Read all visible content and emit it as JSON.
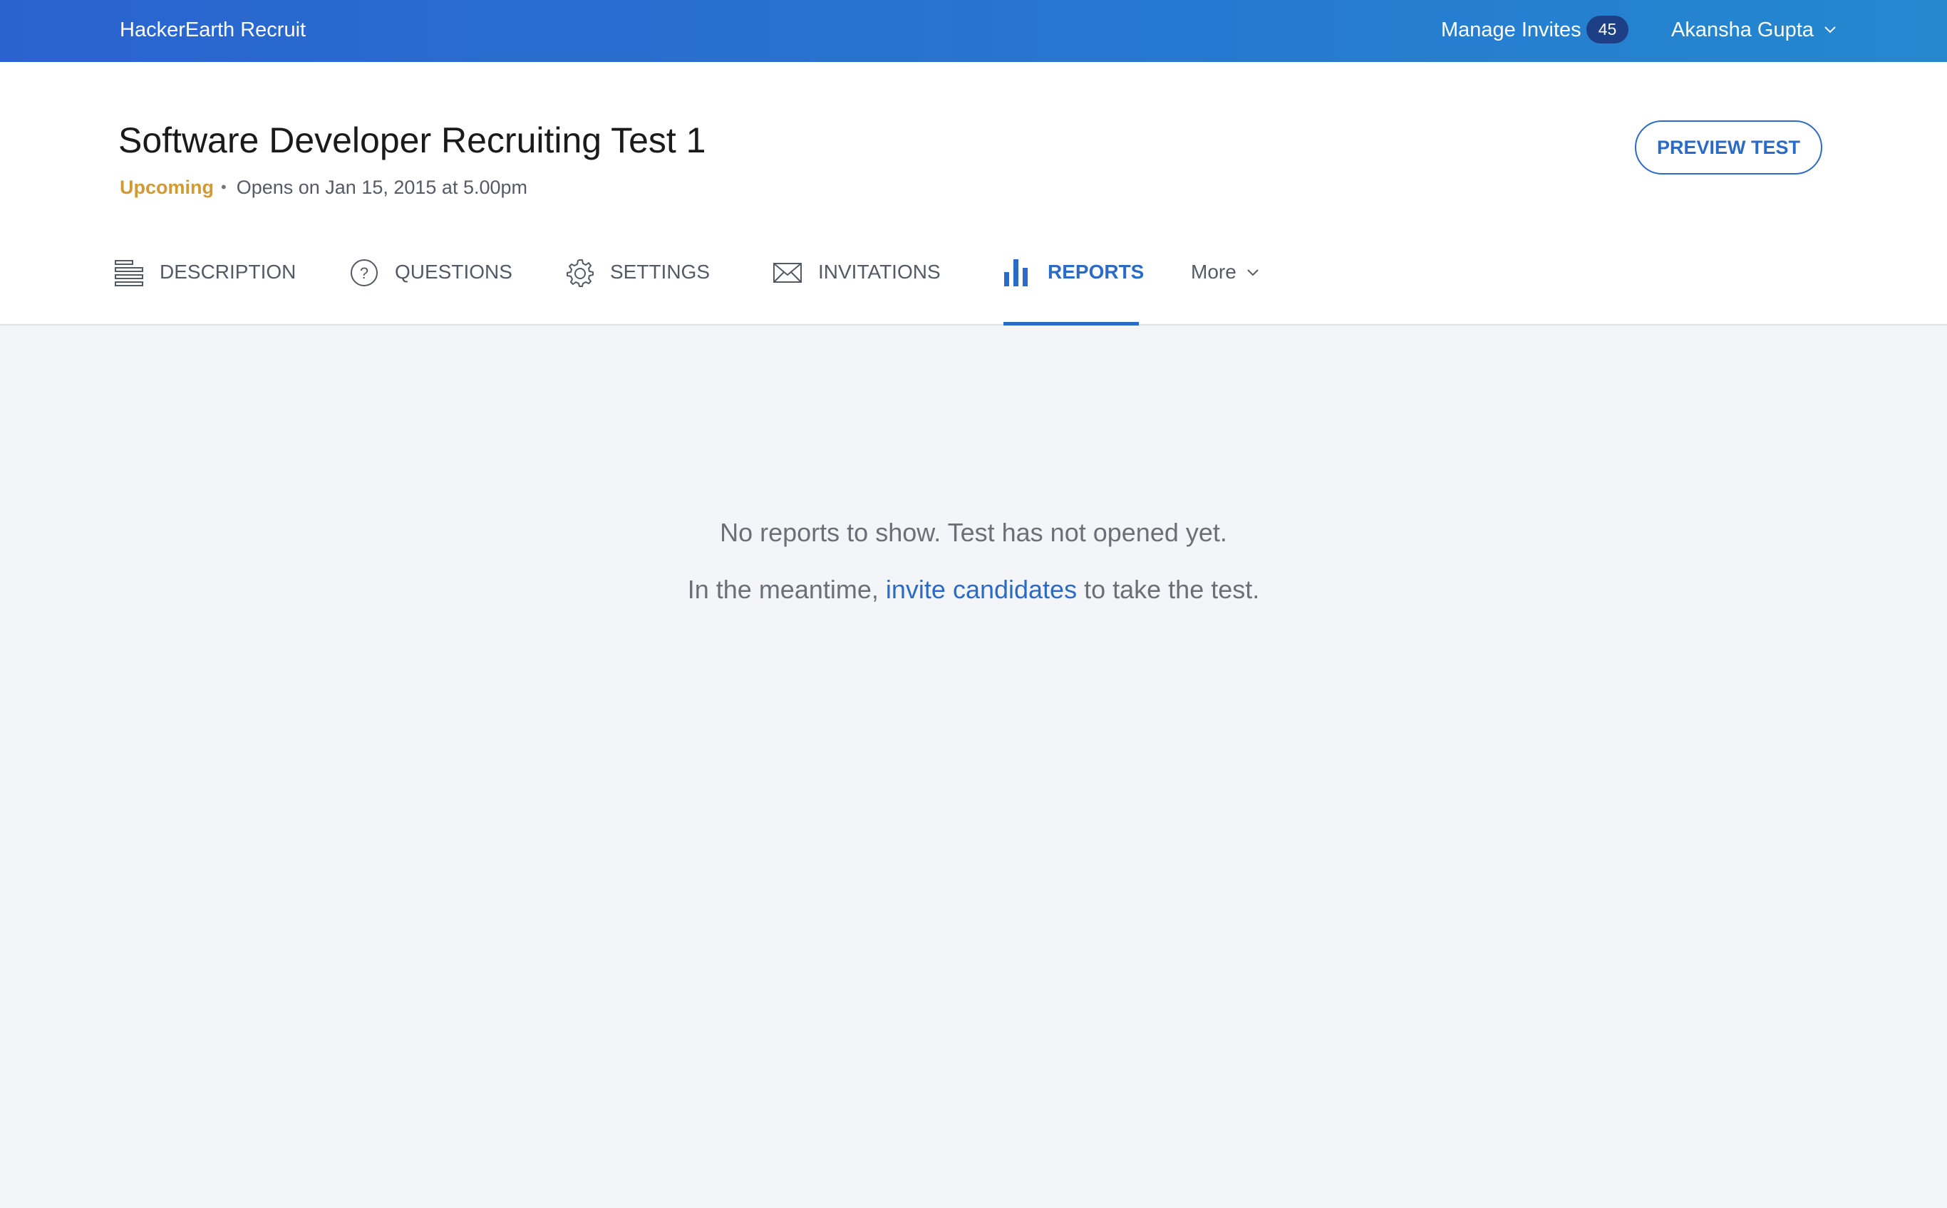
{
  "topbar": {
    "brand": "HackerEarth Recruit",
    "manage_invites_label": "Manage Invites",
    "invites_count": "45",
    "user_name": "Akansha Gupta"
  },
  "header": {
    "title": "Software Developer Recruiting Test 1",
    "status": "Upcoming",
    "opens_text": "Opens on Jan 15, 2015 at 5.00pm",
    "preview_button": "PREVIEW TEST"
  },
  "tabs": [
    {
      "label": "DESCRIPTION",
      "icon": "description-icon",
      "active": false
    },
    {
      "label": "QUESTIONS",
      "icon": "question-circle-icon",
      "active": false
    },
    {
      "label": "SETTINGS",
      "icon": "gear-icon",
      "active": false
    },
    {
      "label": "INVITATIONS",
      "icon": "envelope-icon",
      "active": false
    },
    {
      "label": "REPORTS",
      "icon": "bar-chart-icon",
      "active": true
    },
    {
      "label": "More",
      "icon": "chevron-down-icon",
      "active": false
    }
  ],
  "empty_state": {
    "line1": "No reports to show. Test has not opened yet.",
    "line2_prefix": "In the meantime,",
    "line2_link": "invite candidates",
    "line2_suffix": "to take the test."
  },
  "colors": {
    "accent": "#2a6bc7",
    "topbar_start": "#2a63cf",
    "topbar_end": "#2488cf",
    "upcoming": "#d39a33",
    "badge": "#1d3f86",
    "page_bg": "#f4f5f8"
  }
}
